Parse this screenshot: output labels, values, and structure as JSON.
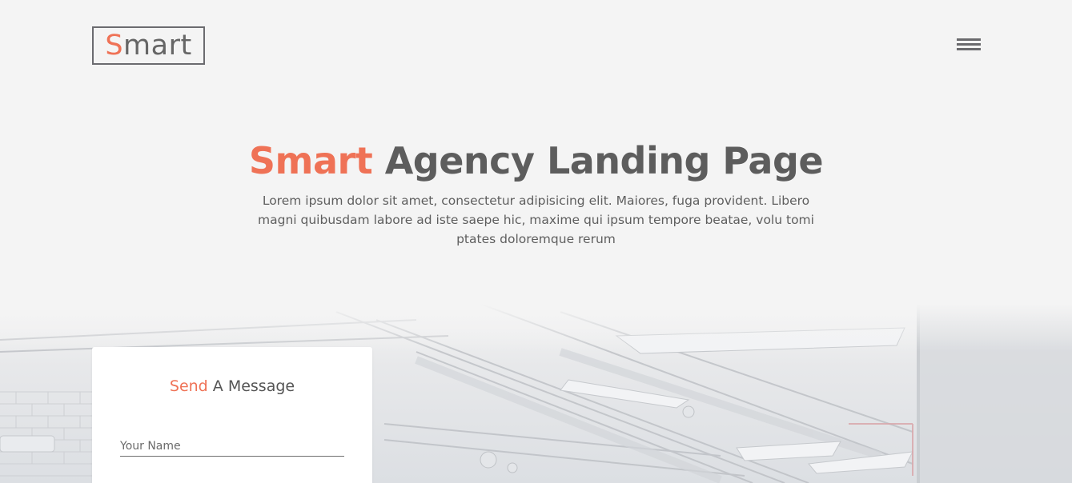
{
  "header": {
    "logo": {
      "accent_letter": "S",
      "rest": "mart"
    },
    "menu_icon": "hamburger-menu-icon"
  },
  "hero": {
    "title_accent": "Smart",
    "title_rest": " Agency Landing Page",
    "description": "Lorem ipsum dolor sit amet, consectetur adipisicing elit. Maiores, fuga provident. Libero magni quibusdam labore ad iste saepe hic, maxime qui ipsum tempore beatae, volu tomi ptates doloremque rerum"
  },
  "contact_form": {
    "title_accent": "Send",
    "title_rest": " A Message",
    "name_placeholder": "Your Name"
  },
  "colors": {
    "accent": "#ef7256",
    "text": "#5d5d5d",
    "background": "#f4f4f4",
    "card": "#ffffff"
  }
}
